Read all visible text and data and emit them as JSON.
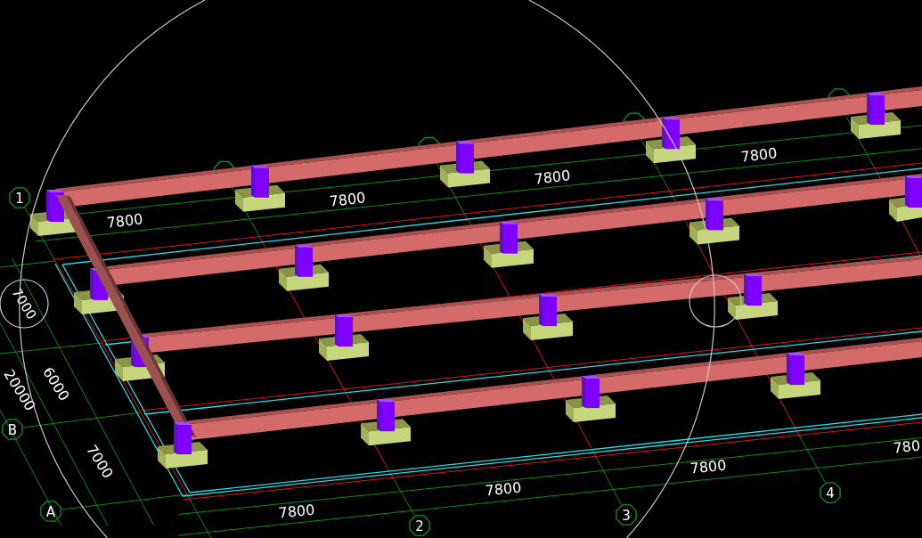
{
  "axis_bubbles": {
    "numbered": [
      "1",
      "2",
      "3",
      "4"
    ],
    "lettered": [
      "B",
      "A"
    ]
  },
  "top_dimensions": [
    "7800",
    "7800",
    "7800",
    "7800"
  ],
  "left_dimensions": [
    "7000",
    "20000",
    "6000",
    "7000"
  ],
  "bottom_dimensions": [
    "7800",
    "7800",
    "7800",
    "780"
  ]
}
